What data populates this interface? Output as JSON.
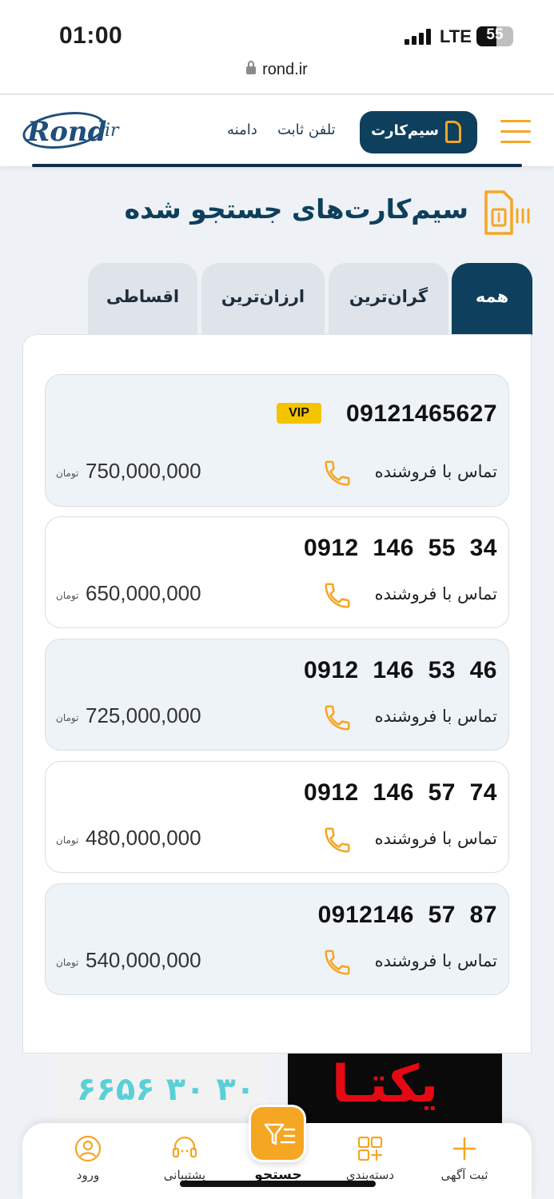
{
  "status_bar": {
    "time": "01:00",
    "network": "LTE",
    "battery": "55",
    "battery_level": 0.55,
    "url": "rond.ir"
  },
  "header": {
    "logo_text": "Rond",
    "logo_suffix": ".ir",
    "nav_links": [
      "تلفن ثابت",
      "دامنه"
    ],
    "sim_button": "سیم‌کارت",
    "menu_icon": "hamburger-icon"
  },
  "page": {
    "title": "سیم‌کارت‌های جستجو شده",
    "title_icon": "sim-card-icon",
    "accent_color": "#F5A623",
    "primary_color": "#0E3F5C"
  },
  "tabs": [
    {
      "label": "همه",
      "active": true
    },
    {
      "label": "گران‌ترین",
      "active": false
    },
    {
      "label": "ارزان‌ترین",
      "active": false
    },
    {
      "label": "اقساطی",
      "active": false
    }
  ],
  "listings": [
    {
      "number": "09121465627",
      "vip": "VIP",
      "contact": "تماس با فروشنده",
      "price": "750,000,000",
      "unit": "تومان"
    },
    {
      "number": "0912  146  55  34",
      "contact": "تماس با فروشنده",
      "price": "650,000,000",
      "unit": "تومان"
    },
    {
      "number": "0912  146  53  46",
      "contact": "تماس با فروشنده",
      "price": "725,000,000",
      "unit": "تومان"
    },
    {
      "number": "0912  146  57  74",
      "contact": "تماس با فروشنده",
      "price": "480,000,000",
      "unit": "تومان"
    },
    {
      "number": "0912146  57  87",
      "contact": "تماس با فروشنده",
      "price": "540,000,000",
      "unit": "تومان"
    }
  ],
  "banners": {
    "left_text": "۶۶۵۶ ۳۰ ۳۰",
    "right_text": "یکتـا"
  },
  "bottom_nav": {
    "items": [
      {
        "label": "ثبت آگهی",
        "icon": "plus-icon"
      },
      {
        "label": "دسته‌بندی",
        "icon": "categories-icon"
      },
      {
        "label": "پشتیبانی",
        "icon": "headset-icon"
      },
      {
        "label": "ورود",
        "icon": "user-icon"
      }
    ],
    "center": {
      "label": "جستجو",
      "icon": "filter-search-icon"
    }
  }
}
